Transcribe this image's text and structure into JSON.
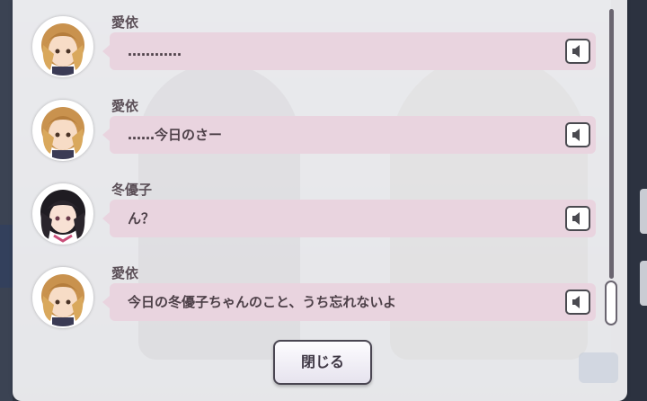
{
  "dialogue_log": {
    "entries": [
      {
        "speaker": "愛依",
        "text": "…………",
        "avatar_icon": "aii-portrait",
        "voice_icon": "speaker-icon"
      },
      {
        "speaker": "愛依",
        "text": "……今日のさー",
        "avatar_icon": "aii-portrait",
        "voice_icon": "speaker-icon"
      },
      {
        "speaker": "冬優子",
        "text": "ん？",
        "avatar_icon": "fuyuko-portrait",
        "voice_icon": "speaker-icon"
      },
      {
        "speaker": "愛依",
        "text": "今日の冬優子ちゃんのこと、うち忘れないよ",
        "avatar_icon": "aii-portrait",
        "voice_icon": "speaker-icon"
      }
    ],
    "close_label": "閉じる"
  },
  "colors": {
    "bubble": "#e9d4df",
    "panel": "#f4f4f6",
    "speaker_text": "#5b4f57"
  }
}
